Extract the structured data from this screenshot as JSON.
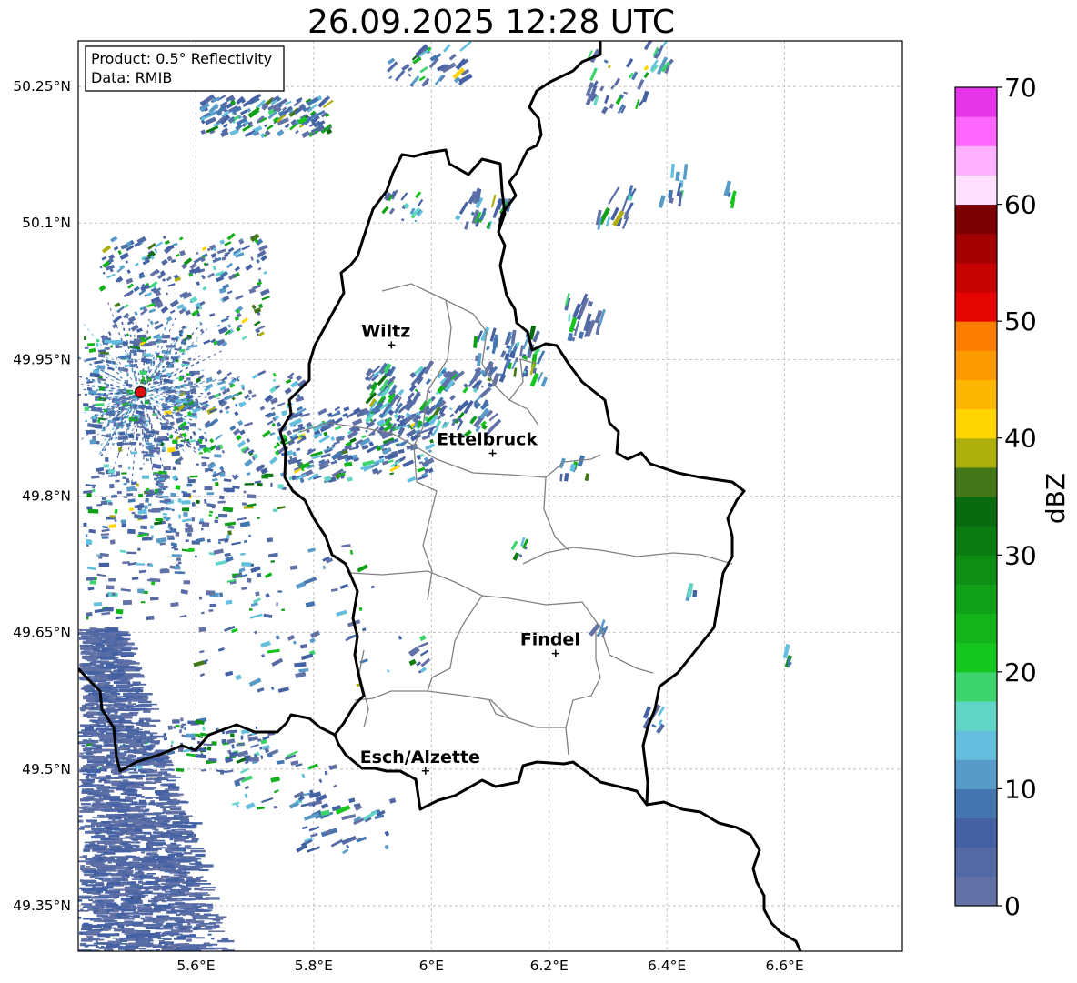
{
  "title": "26.09.2025 12:28 UTC",
  "info_box": {
    "product": "Product: 0.5° Reflectivity",
    "data": "Data: RMIB"
  },
  "map": {
    "lon_range": [
      5.4,
      6.8
    ],
    "lat_range": [
      49.3,
      50.3
    ],
    "x_ticks": [
      {
        "value": 5.6,
        "label": "5.6°E"
      },
      {
        "value": 5.8,
        "label": "5.8°E"
      },
      {
        "value": 6.0,
        "label": "6°E"
      },
      {
        "value": 6.2,
        "label": "6.2°E"
      },
      {
        "value": 6.4,
        "label": "6.4°E"
      },
      {
        "value": 6.6,
        "label": "6.6°E"
      }
    ],
    "y_ticks": [
      {
        "value": 50.25,
        "label": "50.25°N"
      },
      {
        "value": 50.1,
        "label": "50.1°N"
      },
      {
        "value": 49.95,
        "label": "49.95°N"
      },
      {
        "value": 49.8,
        "label": "49.8°N"
      },
      {
        "value": 49.65,
        "label": "49.65°N"
      },
      {
        "value": 49.5,
        "label": "49.5°N"
      },
      {
        "value": 49.35,
        "label": "49.35°N"
      }
    ],
    "cities": [
      {
        "name": "Wiltz",
        "lon": 5.932,
        "lat": 49.966
      },
      {
        "name": "Ettelbruck",
        "lon": 6.104,
        "lat": 49.847
      },
      {
        "name": "Findel",
        "lon": 6.211,
        "lat": 49.627
      },
      {
        "name": "Esch/Alzette",
        "lon": 5.99,
        "lat": 49.498
      }
    ],
    "radar_site": {
      "lon": 5.506,
      "lat": 49.914
    }
  },
  "colorbar": {
    "label": "dBZ",
    "ticks": [
      0,
      10,
      20,
      30,
      40,
      50,
      60,
      70
    ],
    "vmin": 0,
    "vmax": 70,
    "step": 2.5,
    "colors": [
      "#6272a6",
      "#546aa5",
      "#4361a3",
      "#4676af",
      "#589bc8",
      "#64bedd",
      "#61d5c6",
      "#3ed46d",
      "#14c61e",
      "#12b31b",
      "#11a118",
      "#0f8e15",
      "#0c7b12",
      "#0a6a10",
      "#44761a",
      "#adb00a",
      "#fed500",
      "#fdb701",
      "#fd9900",
      "#fb7d00",
      "#e40401",
      "#c50102",
      "#a20001",
      "#7c0001",
      "#ffe0ff",
      "#ffb1ff",
      "#ff66ff",
      "#e635e8"
    ]
  }
}
